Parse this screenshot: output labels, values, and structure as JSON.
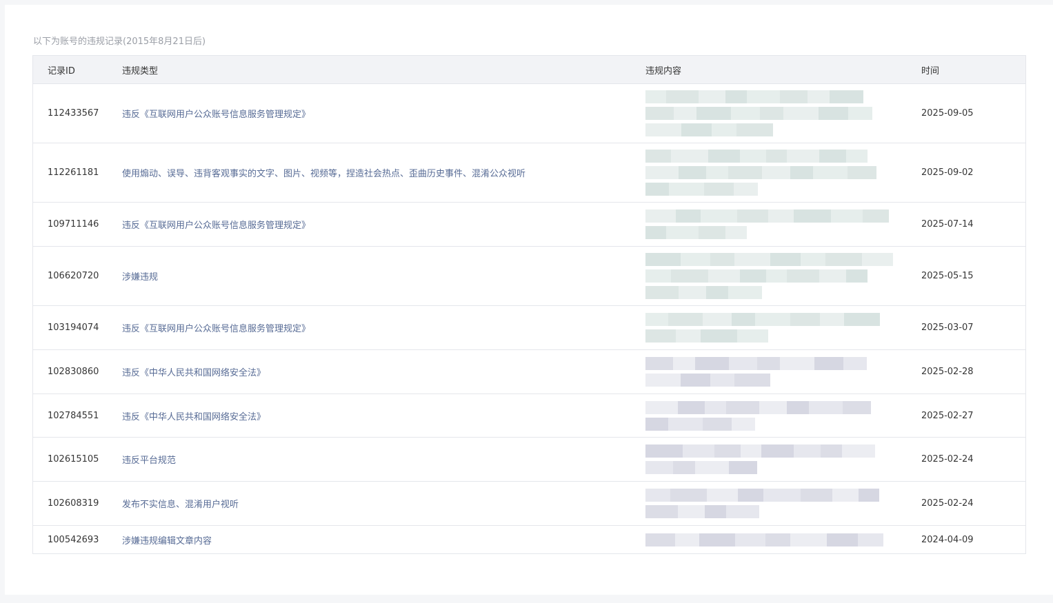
{
  "note": "以下为账号的违规记录(2015年8月21日后)",
  "headers": {
    "id": "记录ID",
    "type": "违规类型",
    "content": "违规内容",
    "time": "时间"
  },
  "rows": [
    {
      "id": "112433567",
      "type": "违反《互联网用户公众账号信息服务管理规定》",
      "time": "2025-09-05"
    },
    {
      "id": "112261181",
      "type": "使用煽动、误导、违背客观事实的文字、图片、视频等，捏造社会热点、歪曲历史事件、混淆公众视听",
      "time": "2025-09-02"
    },
    {
      "id": "109711146",
      "type": "违反《互联网用户公众账号信息服务管理规定》",
      "time": "2025-07-14"
    },
    {
      "id": "106620720",
      "type": "涉嫌违规",
      "time": "2025-05-15"
    },
    {
      "id": "103194074",
      "type": "违反《互联网用户公众账号信息服务管理规定》",
      "time": "2025-03-07"
    },
    {
      "id": "102830860",
      "type": "违反《中华人民共和国网络安全法》",
      "time": "2025-02-28"
    },
    {
      "id": "102784551",
      "type": "违反《中华人民共和国网络安全法》",
      "time": "2025-02-27"
    },
    {
      "id": "102615105",
      "type": "违反平台规范",
      "time": "2025-02-24"
    },
    {
      "id": "102608319",
      "type": "发布不实信息、混淆用户视听",
      "time": "2025-02-24"
    },
    {
      "id": "100542693",
      "type": "涉嫌违规编辑文章内容",
      "time": "2024-04-09"
    }
  ]
}
